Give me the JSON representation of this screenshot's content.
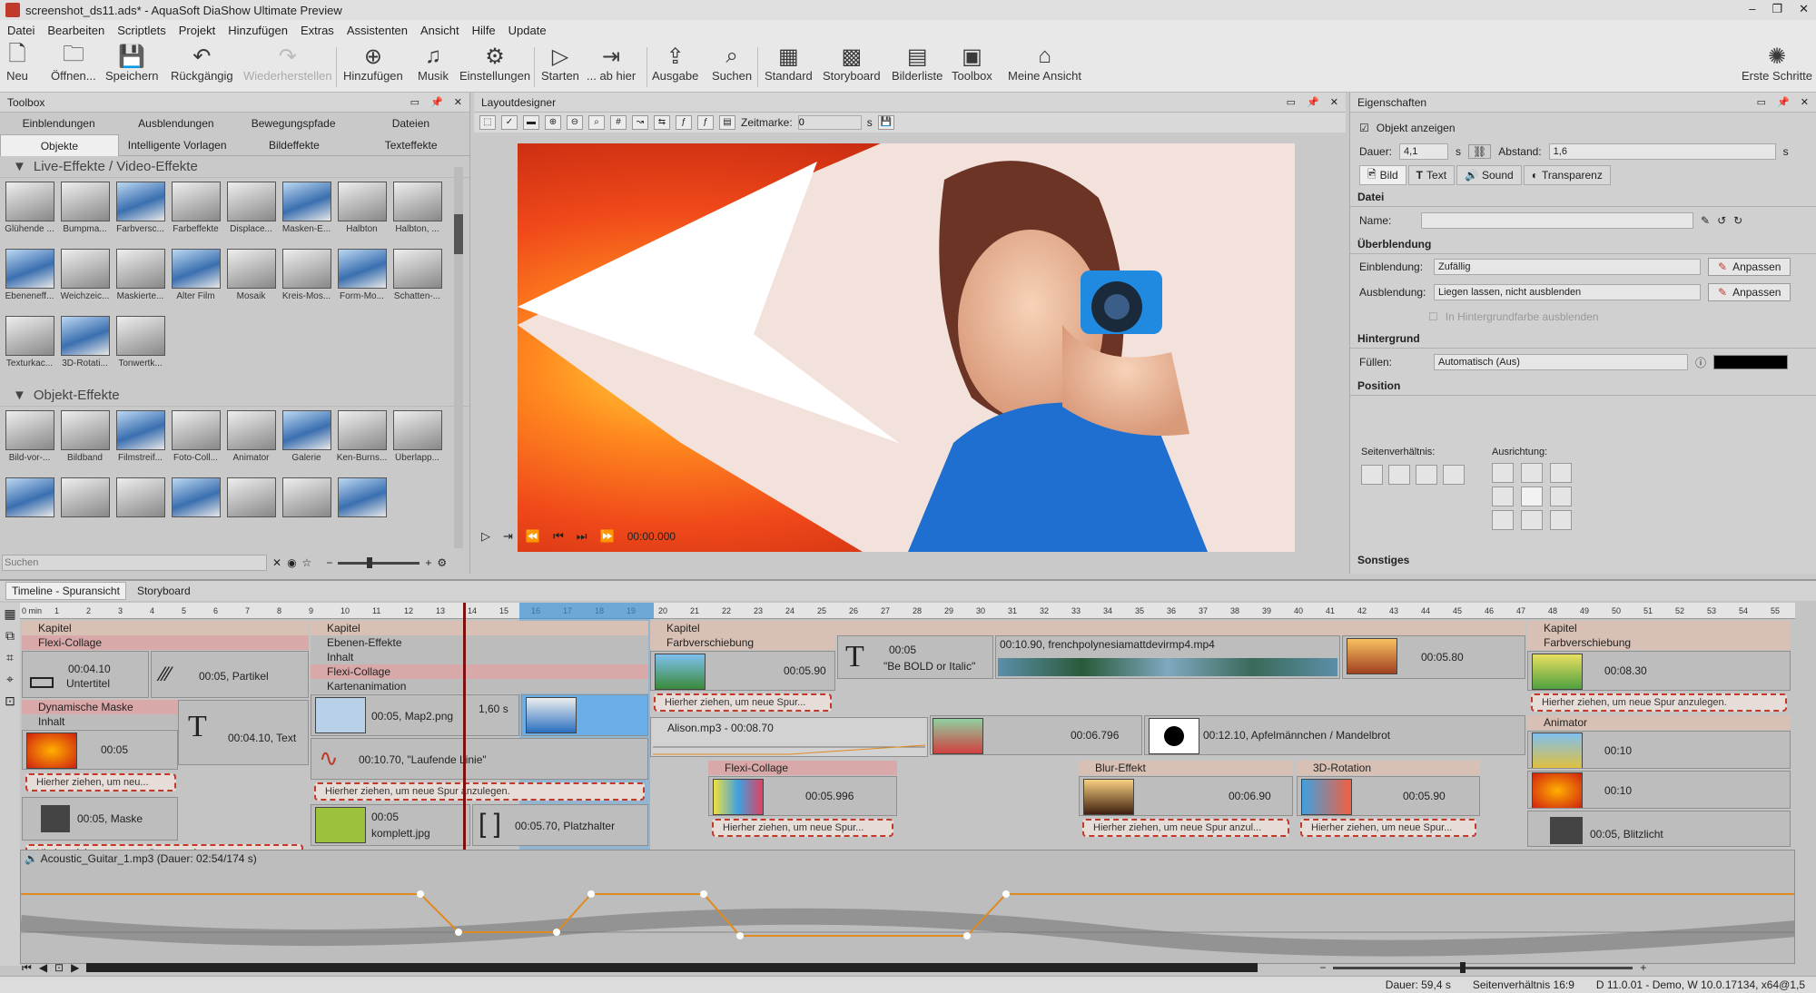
{
  "window": {
    "title": "screenshot_ds11.ads* - AquaSoft DiaShow Ultimate Preview",
    "controls": [
      "–",
      "❐",
      "✕"
    ]
  },
  "menu": [
    "Datei",
    "Bearbeiten",
    "Scriptlets",
    "Projekt",
    "Hinzufügen",
    "Extras",
    "Assistenten",
    "Ansicht",
    "Hilfe",
    "Update"
  ],
  "toolbar": [
    {
      "label": "Neu",
      "icon": "new-icon",
      "glyph": "🗋"
    },
    {
      "label": "Öffnen...",
      "icon": "open-icon",
      "glyph": "🗀"
    },
    {
      "label": "Speichern",
      "icon": "save-icon",
      "glyph": "💾"
    },
    {
      "label": "Rückgängig",
      "icon": "undo-icon",
      "glyph": "↶"
    },
    {
      "label": "Wiederherstellen",
      "icon": "redo-icon",
      "glyph": "↷",
      "disabled": true
    },
    {
      "label": "Hinzufügen",
      "icon": "add-icon",
      "glyph": "⊕"
    },
    {
      "label": "Musik",
      "icon": "music-icon",
      "glyph": "♫"
    },
    {
      "label": "Einstellungen",
      "icon": "settings-icon",
      "glyph": "⚙"
    },
    {
      "label": "Starten",
      "icon": "play-icon",
      "glyph": "▷"
    },
    {
      "label": "... ab hier",
      "icon": "play-from-here-icon",
      "glyph": "⇥"
    },
    {
      "label": "Ausgabe",
      "icon": "export-icon",
      "glyph": "⇪"
    },
    {
      "label": "Suchen",
      "icon": "search-icon",
      "glyph": "⌕"
    },
    {
      "label": "Standard",
      "icon": "layout-standard-icon",
      "glyph": "▦"
    },
    {
      "label": "Storyboard",
      "icon": "storyboard-icon",
      "glyph": "▩"
    },
    {
      "label": "Bilderliste",
      "icon": "image-list-icon",
      "glyph": "▤"
    },
    {
      "label": "Toolbox",
      "icon": "toolbox-icon",
      "glyph": "▣"
    },
    {
      "label": "Meine Ansicht",
      "icon": "my-view-icon",
      "glyph": "⌂"
    },
    {
      "label": "Erste Schritte",
      "icon": "lightbulb-icon",
      "glyph": "✺"
    }
  ],
  "toolbox": {
    "title": "Toolbox",
    "tabs_top": [
      "Einblendungen",
      "Ausblendungen",
      "Bewegungspfade",
      "Dateien"
    ],
    "tabs_bottom": [
      "Objekte",
      "Intelligente Vorlagen",
      "Bildeffekte",
      "Texteffekte"
    ],
    "section1": "Live-Effekte / Video-Effekte",
    "live_effects": [
      "Glühende ...",
      "Bumpma...",
      "Farbversc...",
      "Farbeffekte",
      "Displace...",
      "Masken-E...",
      "Halbton",
      "Halbton, ...",
      "Ebeneneff...",
      "Weichzeic...",
      "Maskierte...",
      "Alter Film",
      "Mosaik",
      "Kreis-Mos...",
      "Form-Mo...",
      "Schatten-...",
      "Texturkac...",
      "3D-Rotati...",
      "Tonwertk..."
    ],
    "section2": "Objekt-Effekte",
    "object_effects": [
      "Bild-vor-...",
      "Bildband",
      "Filmstreif...",
      "Foto-Coll...",
      "Animator",
      "Galerie",
      "Ken-Burns...",
      "Überlapp...",
      "",
      "",
      "",
      "",
      "",
      "",
      ""
    ],
    "search_placeholder": "Suchen"
  },
  "layout": {
    "title": "Layoutdesigner",
    "zeitmarke_label": "Zeitmarke:",
    "zeitmarke_value": "0",
    "zeitmarke_unit": "s",
    "time": "00:00.000"
  },
  "properties": {
    "title": "Eigenschaften",
    "show_object": "Objekt anzeigen",
    "dauer_label": "Dauer:",
    "dauer_value": "4,1",
    "dauer_unit": "s",
    "abstand_label": "Abstand:",
    "abstand_value": "1,6",
    "abstand_unit": "s",
    "tabs": [
      "Bild",
      "Text",
      "Sound",
      "Transparenz"
    ],
    "datei_title": "Datei",
    "name_label": "Name:",
    "ueberblendung_title": "Überblendung",
    "einblendung_label": "Einblendung:",
    "einblendung_value": "Zufällig",
    "ausblendung_label": "Ausblendung:",
    "ausblendung_value": "Liegen lassen, nicht ausblenden",
    "anpassen": "Anpassen",
    "bg_checkbox": "In Hintergrundfarbe ausblenden",
    "hintergrund_title": "Hintergrund",
    "fuellen_label": "Füllen:",
    "fuellen_value": "Automatisch (Aus)",
    "position_title": "Position",
    "seitenverhaeltnis_label": "Seitenverhältnis:",
    "ausrichtung_label": "Ausrichtung:",
    "sonstiges_title": "Sonstiges"
  },
  "timeline": {
    "tabs": [
      "Timeline - Spuransicht",
      "Storyboard"
    ],
    "ruler_start": "0 min",
    "ruler_ticks": [
      "1",
      "2",
      "3",
      "4",
      "5",
      "6",
      "7",
      "8",
      "9",
      "10",
      "11",
      "12",
      "13",
      "14",
      "15",
      "16",
      "17",
      "18",
      "19",
      "20",
      "21",
      "22",
      "23",
      "24",
      "25",
      "26",
      "27",
      "28",
      "29",
      "30",
      "31",
      "32",
      "33",
      "34",
      "35",
      "36",
      "37",
      "38",
      "39",
      "40",
      "41",
      "42",
      "43",
      "44",
      "45",
      "46",
      "47",
      "48",
      "49",
      "50",
      "51",
      "52",
      "53",
      "54",
      "55"
    ],
    "items": {
      "kapitel": "Kapitel",
      "flexi": "Flexi-Collage",
      "untertitel_time": "00:04.10",
      "untertitel": "Untertitel",
      "partikel": "00:05, Partikel",
      "dyn_mask": "Dynamische Maske",
      "inhalt": "Inhalt",
      "t1": "00:05",
      "text_item": "00:04.10, Text",
      "drop": "Hierher ziehen, um neue Spur anzulegen.",
      "drop_short": "Hierher ziehen, um neu...",
      "drop_short2": "Hierher ziehen, um neue Spur...",
      "drop_short3": "Hierher ziehen, um neue Spur anzul...",
      "maske": "00:05, Maske",
      "ebenen": "Ebenen-Effekte",
      "karten": "Kartenanimation",
      "map": "00:05, Map2.png",
      "map_gap": "1,60 s",
      "line": "00:10.70, \"Laufende Linie\"",
      "komplett_time": "00:05",
      "komplett": "komplett.jpg",
      "platzhalter": "00:05.70, Platzhalter",
      "farbv": "Farbverschiebung",
      "t_590": "00:05.90",
      "bold_time": "00:05",
      "bold": "\"Be BOLD or Italic\"",
      "video": "00:10.90, frenchpolynesiamattdevirmp4.mp4",
      "t_580": "00:05.80",
      "alison": "Alison.mp3 - 00:08.70",
      "t_6796": "00:06.796",
      "apfel": "00:12.10, Apfelmännchen / Mandelbrot",
      "flexi2": "Flexi-Collage",
      "t_5996": "00:05.996",
      "blur": "Blur-Effekt",
      "t_690": "00:06.90",
      "rot3d": "3D-Rotation",
      "t_590b": "00:05.90",
      "t_830": "00:08.30",
      "animator": "Animator",
      "t_10": "00:10",
      "blitz": "00:05, Blitzlicht",
      "audio": "Acoustic_Guitar_1.mp3 (Dauer: 02:54/174 s)"
    }
  },
  "status": [
    "Dauer: 59,4 s",
    "Seitenverhältnis 16:9",
    "D 11.0.01 - Demo, W 10.0.17134, x64@1,5"
  ],
  "colors": {
    "accent": "#c0392b",
    "kapitel": "#d8c0b4",
    "flexi": "#d9a8a8",
    "selection": "#3a8fd0"
  }
}
